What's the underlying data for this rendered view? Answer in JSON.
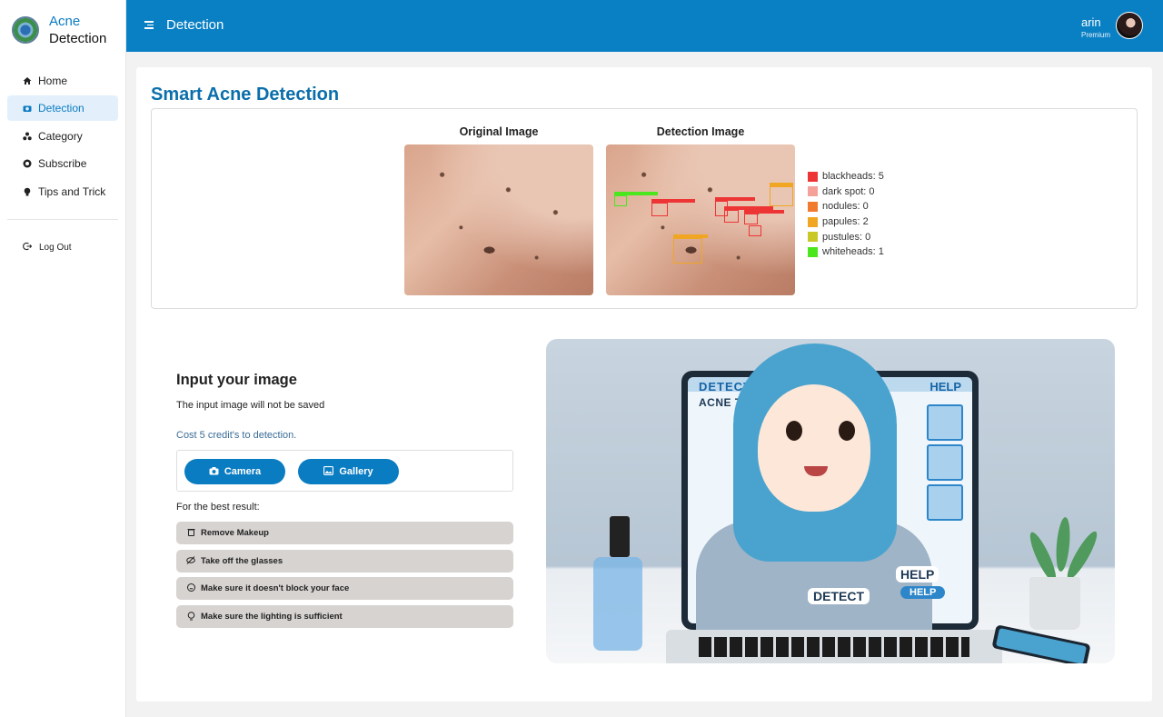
{
  "app": {
    "brand_line1": "Acne",
    "brand_line2": "Detection",
    "logo_icon": "acne-logo"
  },
  "sidebar": {
    "items": [
      {
        "label": "Home",
        "icon": "home-icon",
        "active": false
      },
      {
        "label": "Detection",
        "icon": "camera-icon",
        "active": true
      },
      {
        "label": "Category",
        "icon": "category-icon",
        "active": false
      },
      {
        "label": "Subscribe",
        "icon": "subscribe-icon",
        "active": false
      },
      {
        "label": "Tips and Trick",
        "icon": "bulb-icon",
        "active": false
      }
    ],
    "logout_label": "Log Out"
  },
  "header": {
    "title": "Detection",
    "user_name": "arin",
    "user_plan": "Premium"
  },
  "page": {
    "title": "Smart Acne Detection",
    "original_label": "Original Image",
    "detection_label": "Detection Image"
  },
  "legend": [
    {
      "label": "blackheads: 5",
      "color": "#ee3535"
    },
    {
      "label": "dark spot: 0",
      "color": "#f4a19a"
    },
    {
      "label": "nodules: 0",
      "color": "#f07a2e"
    },
    {
      "label": "papules: 2",
      "color": "#f0a623"
    },
    {
      "label": "pustules: 0",
      "color": "#c8c827"
    },
    {
      "label": "whiteheads: 1",
      "color": "#4ce61f"
    }
  ],
  "input": {
    "title": "Input your image",
    "subtitle": "The input image will not be saved",
    "cost_text": "Cost 5 credit's to detection.",
    "camera_label": "Camera",
    "gallery_label": "Gallery",
    "best_result_label": "For the best result:",
    "tips": [
      {
        "label": "Remove Makeup",
        "icon": "trash-icon"
      },
      {
        "label": "Take off the glasses",
        "icon": "eye-off-icon"
      },
      {
        "label": "Make sure it doesn't block your face",
        "icon": "face-icon"
      },
      {
        "label": "Make sure the lighting is sufficient",
        "icon": "bulb-icon"
      }
    ]
  },
  "illustration": {
    "screen_left_title": "DETECT",
    "screen_subtitle": "ACNE TYPES",
    "screen_right_title": "HELP",
    "label_detect": "DETECT",
    "label_help": "HELP",
    "label_help_button": "HELP"
  }
}
